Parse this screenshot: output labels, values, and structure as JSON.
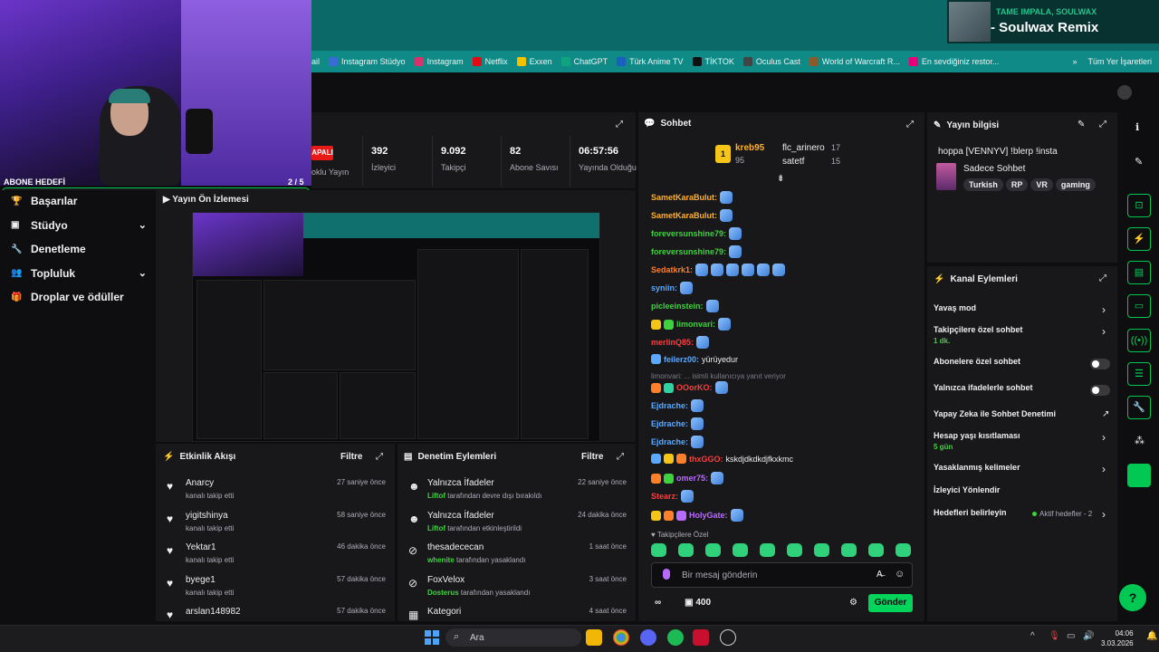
{
  "music": {
    "artist": "TAME IMPALA, SOULWAX",
    "track": "- Soulwax Remix"
  },
  "bookmarks": [
    {
      "label": "ail",
      "color": ""
    },
    {
      "label": "Instagram Stüdyo",
      "color": "#3b6bd6"
    },
    {
      "label": "Instagram",
      "color": "#d6336c"
    },
    {
      "label": "Netflix",
      "color": "#e50914"
    },
    {
      "label": "Exxen",
      "color": "#f2c200"
    },
    {
      "label": "ChatGPT",
      "color": "#10a37f"
    },
    {
      "label": "Türk Anime TV",
      "color": "#1b5fbf"
    },
    {
      "label": "TİKTOK",
      "color": "#111111"
    },
    {
      "label": "Oculus Cast",
      "color": "#444"
    },
    {
      "label": "World of Warcraft R...",
      "color": "#8a5a2b"
    },
    {
      "label": "En sevdiğiniz restor...",
      "color": "#e6007a"
    }
  ],
  "bookmarks_more": "»",
  "bookmarks_all": "Tüm Yer İşaretleri",
  "goal": {
    "label": "ABONE HEDEFİ",
    "count": "2 / 5",
    "progress": 0.4
  },
  "nav": [
    {
      "label": "Başarılar",
      "icon": "trophy-icon",
      "chevron": false
    },
    {
      "label": "Stüdyo",
      "icon": "studio-icon",
      "chevron": true
    },
    {
      "label": "Denetleme",
      "icon": "wrench-icon",
      "chevron": false
    },
    {
      "label": "Topluluk",
      "icon": "community-icon",
      "chevron": true
    },
    {
      "label": "Droplar ve ödüller",
      "icon": "gift-icon",
      "chevron": false
    }
  ],
  "stats": {
    "live": "APALI",
    "items": [
      {
        "value": "",
        "label": "oklu Yayın"
      },
      {
        "value": "392",
        "label": "İzleyici"
      },
      {
        "value": "9.092",
        "label": "Takipçi"
      },
      {
        "value": "82",
        "label": "Abone Savısı"
      },
      {
        "value": "06:57:56",
        "label": "Yayında Olduğu"
      }
    ]
  },
  "preview": {
    "title": "Yayın Ön İzlemesi"
  },
  "feed": {
    "title": "Etkinlik Akışı",
    "filter": "Filtre",
    "rows": [
      {
        "name": "Anarcy",
        "sub": "kanalı takip etti",
        "time": "27 saniye önce"
      },
      {
        "name": "yigitshinya",
        "sub": "kanalı takip etti",
        "time": "58 saniye önce"
      },
      {
        "name": "Yektar1",
        "sub": "kanalı takip etti",
        "time": "46 dakika önce"
      },
      {
        "name": "byege1",
        "sub": "kanalı takip etti",
        "time": "57 dakika önce"
      },
      {
        "name": "arslan148982",
        "sub": "",
        "time": "57 dakika önce"
      }
    ]
  },
  "modlog": {
    "title": "Denetim Eylemleri",
    "filter": "Filtre",
    "rows": [
      {
        "name": "Yalnızca İfadeler",
        "actor": "Liftof",
        "sub": "tarafından devre dışı bırakıldı",
        "time": "22 saniye önce",
        "icon": "emote-icon"
      },
      {
        "name": "Yalnızca İfadeler",
        "actor": "Liftof",
        "sub": "tarafından etkinleştirildi",
        "time": "24 dakika önce",
        "icon": "emote-icon"
      },
      {
        "name": "thesadececan",
        "actor": "whenite",
        "sub": "tarafından yasaklandı",
        "time": "1 saat önce",
        "icon": "ban-icon"
      },
      {
        "name": "FoxVelox",
        "actor": "Dosterus",
        "sub": "tarafından yasaklandı",
        "time": "3 saat önce",
        "icon": "ban-icon"
      },
      {
        "name": "Kategori",
        "actor": "",
        "sub": "",
        "time": "4 saat önce",
        "icon": "category-icon"
      }
    ]
  },
  "chat": {
    "title": "Sohbet",
    "leader": [
      {
        "name": "kreb95",
        "points": "95"
      },
      {
        "name": "flc_arinero",
        "points": "17"
      },
      {
        "name": "satetf",
        "points": "15"
      }
    ],
    "messages": [
      {
        "name": "SametKaraBulut:",
        "color": "#ffb02e",
        "text": "",
        "emotes": 1
      },
      {
        "name": "SametKaraBulut:",
        "color": "#ffb02e",
        "text": "",
        "emotes": 1
      },
      {
        "name": "foreversunshine79:",
        "color": "#3ed23e",
        "text": "",
        "emotes": 1
      },
      {
        "name": "foreversunshine79:",
        "color": "#3ed23e",
        "text": "",
        "emotes": 1
      },
      {
        "name": "Sedatkrk1:",
        "color": "#ff7f2a",
        "text": "",
        "emotes": 6
      },
      {
        "name": "syniin:",
        "color": "#5aa9ff",
        "text": "",
        "emotes": 1
      },
      {
        "name": "picleeinstein:",
        "color": "#3ed23e",
        "text": "",
        "emotes": 1
      },
      {
        "name": "limonvari:",
        "color": "#3ed23e",
        "text": "",
        "emotes": 1
      },
      {
        "name": "merlinQ85:",
        "color": "#ff3c3c",
        "text": "",
        "emotes": 1
      },
      {
        "name": "feilerz00:",
        "color": "#5aa9ff",
        "text": "yürüyedur",
        "emotes": 0
      },
      {
        "name": "OOorKO:",
        "color": "#ff3c3c",
        "text": "",
        "emotes": 1
      },
      {
        "name": "Ejdrache:",
        "color": "#5aa9ff",
        "text": "",
        "emotes": 1
      },
      {
        "name": "Ejdrache:",
        "color": "#5aa9ff",
        "text": "",
        "emotes": 1
      },
      {
        "name": "Ejdrache:",
        "color": "#5aa9ff",
        "text": "",
        "emotes": 1
      },
      {
        "name": "thxGGO:",
        "color": "#ff3c3c",
        "text": "kskdjdkdkdjfkxkmc",
        "emotes": 0
      },
      {
        "name": "omer75:",
        "color": "#b86bff",
        "text": "",
        "emotes": 1
      },
      {
        "name": "Stearz:",
        "color": "#ff3c3c",
        "text": "",
        "emotes": 1
      },
      {
        "name": "HolyGate:",
        "color": "#b86bff",
        "text": "",
        "emotes": 1
      }
    ],
    "reply_line": "limonvari: ... isimli kullanıcıya yanıt veriyor",
    "follow_only": "Takipçilere Özel",
    "input_placeholder": "Bir mesaj gönderin",
    "points": "400",
    "send": "Gönder"
  },
  "info": {
    "title": "Yayın bilgisi",
    "stream_title": "hoppa [VENNYV] !blerp !insta",
    "category": "Sadece Sohbet",
    "tags": [
      "Turkish",
      "RP",
      "VR",
      "gaming"
    ]
  },
  "actions": {
    "title": "Kanal Eylemleri",
    "items": [
      {
        "label": "Yavaş mod",
        "sub": "",
        "control": "chevron"
      },
      {
        "label": "Takipçilere özel sohbet",
        "sub": "1 dk.",
        "control": "chevron"
      },
      {
        "label": "Abonelere özel sohbet",
        "sub": "",
        "control": "toggle"
      },
      {
        "label": "Yalnızca ifadelerle sohbet",
        "sub": "",
        "control": "toggle"
      },
      {
        "label": "Yapay Zeka ile Sohbet Denetimi",
        "sub": "",
        "control": "external"
      },
      {
        "label": "Hesap yaşı kısıtlaması",
        "sub": "5 gün",
        "control": "chevron"
      },
      {
        "label": "Yasaklanmış kelimeler",
        "sub": "",
        "control": "chevron"
      },
      {
        "label": "İzleyici Yönlendir",
        "sub": "",
        "control": "none"
      },
      {
        "label": "Hedefleri belirleyin",
        "sub": "",
        "control": "chevron",
        "status": "Aktif hedefler - 2"
      }
    ]
  },
  "taskbar": {
    "search": "Ara",
    "time": "04:06",
    "date": "3.03.2026"
  }
}
